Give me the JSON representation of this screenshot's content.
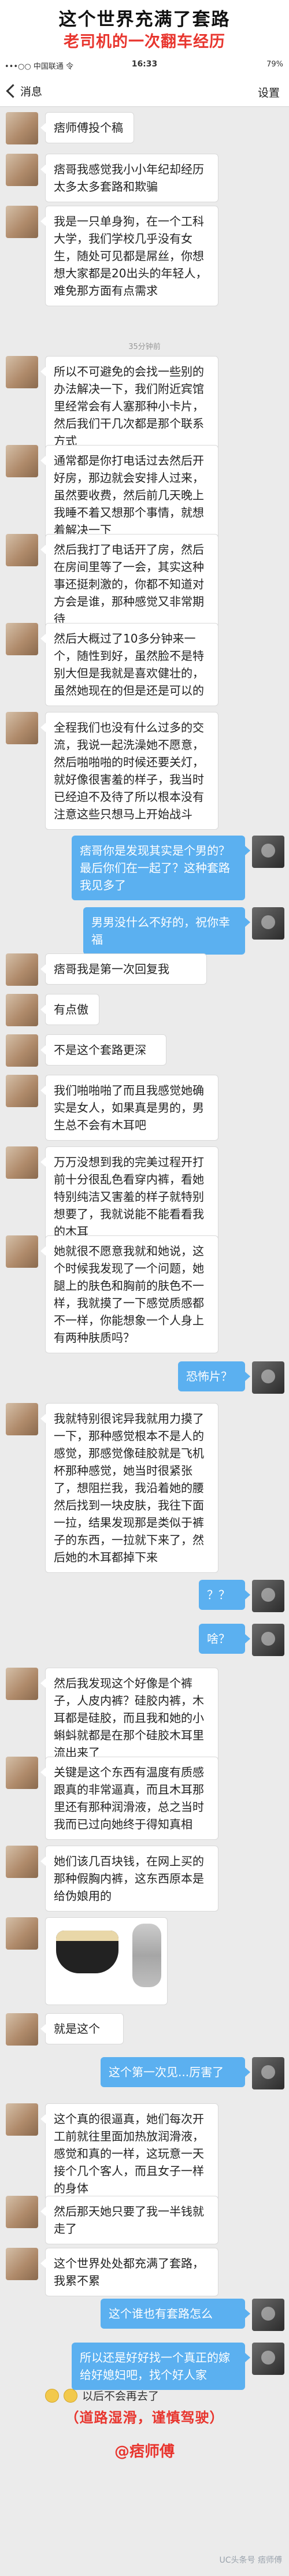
{
  "header": {
    "title": "这个世界充满了套路",
    "subtitle": "老司机的一次翻车经历"
  },
  "status_bar": {
    "carrier": "•••○○ 中国联通 令",
    "time": "16:33",
    "battery": "79%"
  },
  "nav": {
    "back_label": "消息",
    "settings_label": "设置"
  },
  "time_divider": "35分钟前",
  "messages": [
    {
      "side": "left",
      "text": "痞师傅投个稿"
    },
    {
      "side": "left",
      "text": "痞哥我感觉我小小年纪却经历太多太多套路和欺骗"
    },
    {
      "side": "left",
      "text": "我是一只单身狗，在一个工科大学，我们学校几乎没有女生，随处可见都是屌丝，你想想大家都是20出头的年轻人，难免那方面有点需求"
    },
    {
      "side": "left",
      "text": "所以不可避免的会找一些别的办法解决一下，我们附近宾馆里经常会有人塞那种小卡片，然后我们干几次都是那个联系方式"
    },
    {
      "side": "left",
      "text": "通常都是你打电话过去然后开好房，那边就会安排人过来，虽然要收费，然后前几天晚上我睡不着又想那个事情，就想着解决一下"
    },
    {
      "side": "left",
      "text": "然后我打了电话开了房，然后在房间里等了一会，其实这种事还挺刺激的，你都不知道对方会是谁，那种感觉又非常期待"
    },
    {
      "side": "left",
      "text": "然后大概过了10多分钟来一个，随性到好，虽然脸不是特别大但是我就是喜欢健壮的，虽然她现在的但是还是可以的"
    },
    {
      "side": "left",
      "text": "全程我们也没有什么过多的交流，我说一起洗澡她不愿意，然后啪啪啪的时候还要关灯，就好像很害羞的样子，我当时已经迫不及待了所以根本没有注意这些只想马上开始战斗"
    },
    {
      "side": "right",
      "text": "痞哥你是发现其实是个男的？最后你们在一起了？这种套路我见多了"
    },
    {
      "side": "right",
      "text": "男男没什么不好的，祝你幸福"
    },
    {
      "side": "left",
      "text": "痞哥我是第一次回复我"
    },
    {
      "side": "left",
      "text": "有点傲"
    },
    {
      "side": "left",
      "text": "不是这个套路更深"
    },
    {
      "side": "left",
      "text": "我们啪啪啪了而且我感觉她确实是女人，如果真是男的，男生总不会有木耳吧"
    },
    {
      "side": "left",
      "text": "万万没想到我的完美过程开打前十分很乱色看穿内裤，看她特别纯洁又害羞的样子就特别想要了，我就说能不能看看我的木耳"
    },
    {
      "side": "left",
      "text": "她就很不愿意我就和她说，这个时候我发现了一个问题，她腿上的肤色和胸前的肤色不一样，我就摸了一下感觉质感都不一样，你能想象一个人身上有两种肤质吗？"
    },
    {
      "side": "right",
      "text": "恐怖片？"
    },
    {
      "side": "left",
      "text": "我就特别很诧异我就用力摸了一下，那种感觉根本不是人的感觉，那感觉像硅胶就是飞机杯那种感觉，她当时很紧张了，想阻拦我，我沿着她的腰然后找到一块皮肤，我往下面一拉，结果发现那是类似于裤子的东西，一拉就下来了，然后她的木耳都掉下来"
    },
    {
      "side": "right",
      "text": "？？"
    },
    {
      "side": "right",
      "text": "啥？"
    },
    {
      "side": "left",
      "text": "然后我发现这个好像是个裤子，人皮内裤？硅胶内裤，木耳都是硅胶，而且我和她的小蝌蚪就都是在那个硅胶木耳里流出来了"
    },
    {
      "side": "left",
      "text": "关键是这个东西有温度有质感跟真的非常逼真，而且木耳那里还有那种润滑液，总之当时我而已过向她终于得知真相"
    },
    {
      "side": "left",
      "text": "她们该几百块钱，在网上买的那种假胸内裤，这东西原本是给伪娘用的"
    },
    {
      "side": "left",
      "text": "就是这个"
    },
    {
      "side": "right",
      "text": "这个第一次见...厉害了"
    },
    {
      "side": "left",
      "text": "这个真的很逼真，她们每次开工前就往里面加热放润滑液，感觉和真的一样，这玩意一天接个几个客人，而且女子一样的身体"
    },
    {
      "side": "left",
      "text": "然后那天她只要了我一半钱就走了"
    },
    {
      "side": "left",
      "text": "这个世界处处都充满了套路，我累不累"
    },
    {
      "side": "right",
      "text": "这个谁也有套路怎么"
    },
    {
      "side": "right",
      "text": "所以还是好好找一个真正的嫁给好媳妇吧，找个好人家"
    }
  ],
  "photo_caption": "photo",
  "last_emoji_text": "以后不会再去了",
  "footer": {
    "warning": "（道路湿滑，谨慎驾驶）",
    "author": "@痞师傅",
    "watermark": "UC头条号 痞师傅"
  },
  "colors": {
    "accent_red": "#e8352e",
    "bubble_blue": "#5bb0f0",
    "chat_bg": "#ebebeb"
  }
}
